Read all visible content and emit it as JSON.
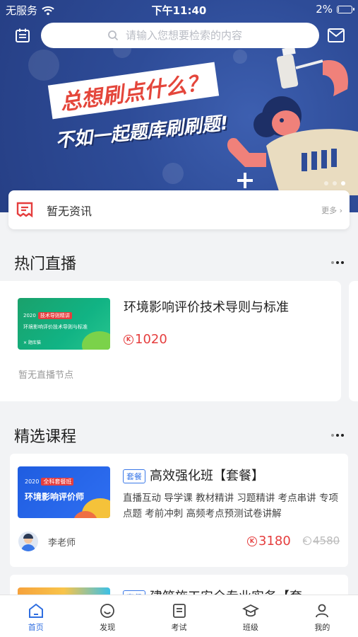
{
  "status_bar": {
    "carrier": "无服务",
    "time": "下午11:40",
    "battery": "2%",
    "battery_level": 0.02
  },
  "search": {
    "placeholder": "请输入您想要检索的内容"
  },
  "banner": {
    "headline_1": "总想刷点什么？",
    "headline_2": "不如一起题库刷刷题!",
    "slide_count": 3,
    "active_slide": 2
  },
  "news": {
    "title": "暂无资讯",
    "more": "更多 ›"
  },
  "live_section": {
    "title": "热门直播",
    "course": {
      "thumb_year": "2020",
      "thumb_tag": "技术导则精讲",
      "thumb_title": "环境影响评价技术导则与标准",
      "thumb_brand": "✕ 题库猫",
      "title": "环境影响评价技术导则与标准",
      "price": "1020",
      "note": "暂无直播节点"
    }
  },
  "course_section": {
    "title": "精选课程",
    "courses": [
      {
        "thumb_year": "2020",
        "thumb_tag": "全科套餐班",
        "thumb_title": "环境影响评价师",
        "badge": "套餐",
        "title": "高效强化班【套餐】",
        "desc": "直播互动 导学课 教材精讲 习题精讲 考点串讲 专项点题 考前冲刺 高频考点预测试卷讲解",
        "teacher": "李老师",
        "price": "3180",
        "original_price": "4580"
      },
      {
        "badge": "套餐",
        "title": "建筑施工安全专业实务【套"
      }
    ]
  },
  "tabbar": {
    "tabs": [
      {
        "label": "首页",
        "icon": "home-icon",
        "active": true
      },
      {
        "label": "发现",
        "icon": "discover-icon"
      },
      {
        "label": "考试",
        "icon": "exam-icon"
      },
      {
        "label": "班级",
        "icon": "class-icon"
      },
      {
        "label": "我的",
        "icon": "profile-icon"
      }
    ]
  },
  "colors": {
    "accent": "#2f6ee0",
    "price": "#e53e3e",
    "banner": "#2e4c98"
  }
}
